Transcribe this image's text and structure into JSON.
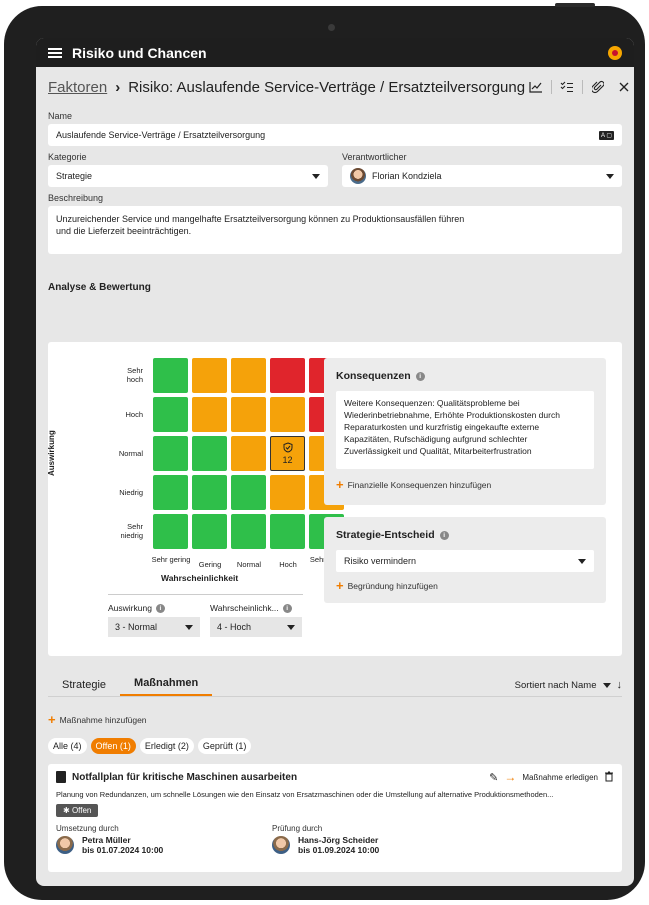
{
  "app": {
    "title": "Risiko und Chancen"
  },
  "breadcrumb": {
    "parent": "Faktoren",
    "current": "Risiko: Auslaufende Service-Verträge / Ersatzteilversorgung"
  },
  "form": {
    "name_label": "Name",
    "name_value": "Auslaufende Service-Verträge / Ersatzteilversorgung",
    "category_label": "Kategorie",
    "category_value": "Strategie",
    "owner_label": "Verantwortlicher",
    "owner_value": "Florian Kondziela",
    "description_label": "Beschreibung",
    "description_line1": "Unzureichender Service und mangelhafte Ersatzteilversorgung können zu Produktionsausfällen führen",
    "description_line2": "und die Lieferzeit beeinträchtigen."
  },
  "analysis": {
    "title": "Analyse & Bewertung",
    "y_axis": "Auswirkung",
    "x_axis": "Wahrscheinlichkeit",
    "y_labels": [
      "Sehr hoch",
      "Hoch",
      "Normal",
      "Niedrig",
      "Sehr niedrig"
    ],
    "x_labels": [
      "Sehr gering",
      "Gering",
      "Normal",
      "Hoch",
      "Sehr hoch"
    ],
    "grid_colors": [
      [
        "green",
        "orange",
        "orange",
        "red",
        "red"
      ],
      [
        "green",
        "orange",
        "orange",
        "orange",
        "red"
      ],
      [
        "green",
        "green",
        "orange",
        "orange",
        "orange"
      ],
      [
        "green",
        "green",
        "green",
        "orange",
        "orange"
      ],
      [
        "green",
        "green",
        "green",
        "green",
        "green"
      ]
    ],
    "selected_value": "12",
    "impact_label": "Auswirkung",
    "impact_value": "3 - Normal",
    "probability_label": "Wahrscheinlichk...",
    "probability_value": "4 - Hoch",
    "colors": {
      "green": "#2fbf4a",
      "orange": "#f5a20a",
      "red": "#e0252c"
    }
  },
  "consequences": {
    "title": "Konsequenzen",
    "lines": [
      "Weitere Konsequenzen: Qualitätsprobleme bei",
      "Wiederinbetriebnahme, Erhöhte Produktionskosten durch",
      "Reparaturkosten und kurzfristig eingekaufte externe",
      "Kapazitäten, Rufschädigung aufgrund schlechter",
      "Zuverlässigkeit und Qualität, Mitarbeiterfrustration"
    ],
    "add_label": "Finanzielle Konsequenzen hinzufügen"
  },
  "strategy": {
    "title": "Strategie-Entscheid",
    "value": "Risiko vermindern",
    "add_label": "Begründung hinzufügen"
  },
  "tabs": {
    "strategy": "Strategie",
    "measures": "Maßnahmen",
    "sort": "Sortiert nach Name"
  },
  "measures": {
    "add_label": "Maßnahme hinzufügen",
    "filters": {
      "all": "Alle (4)",
      "open": "Offen (1)",
      "done": "Erledigt (2)",
      "checked": "Geprüft (1)"
    },
    "item": {
      "title": "Notfallplan für kritische Maschinen ausarbeiten",
      "description": "Planung von Redundanzen, um schnelle Lösungen wie den Einsatz von Ersatzmaschinen oder die Umstellung auf alternative Produktionsmethoden...",
      "complete_label": "Maßnahme erledigen",
      "status": "Offen",
      "impl_label": "Umsetzung durch",
      "impl_name": "Petra Müller",
      "impl_date": "bis 01.07.2024 10:00",
      "review_label": "Prüfung durch",
      "review_name": "Hans-Jörg Scheider",
      "review_date": "bis 01.09.2024 10:00"
    }
  },
  "accent": "#f07d00"
}
